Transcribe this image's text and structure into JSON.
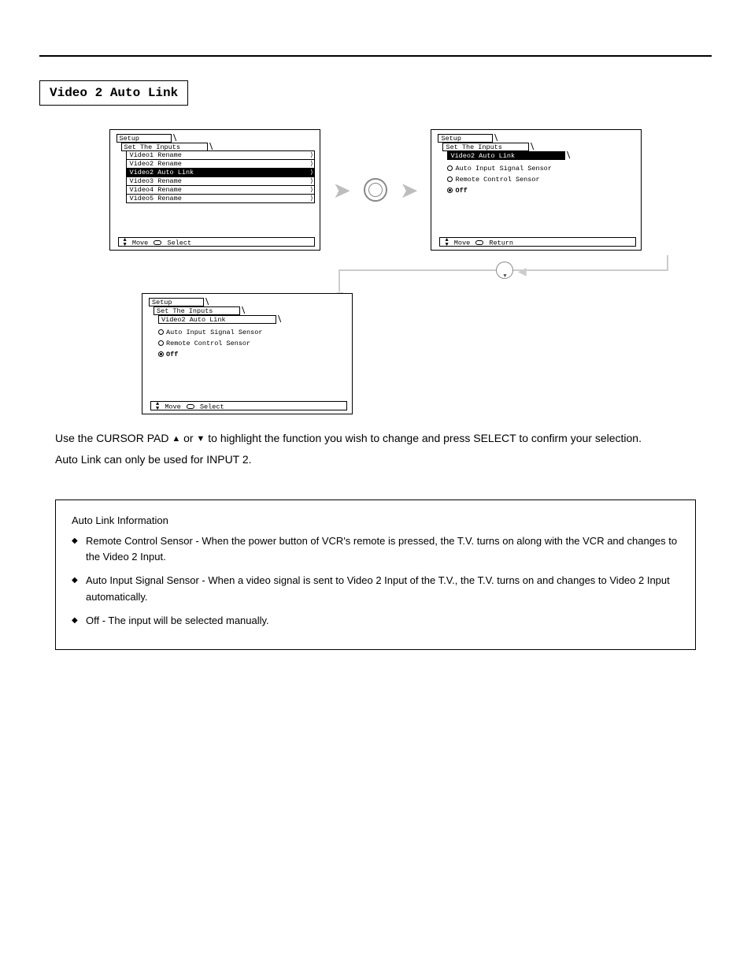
{
  "section_title": "Video 2 Auto Link",
  "screen1": {
    "tab1": "Setup",
    "tab2": "Set The Inputs",
    "items": [
      {
        "label": "Video1 Rename",
        "sel": false
      },
      {
        "label": "Video2 Rename",
        "sel": false
      },
      {
        "label": "Video2 Auto Link",
        "sel": true
      },
      {
        "label": "Video3 Rename",
        "sel": false
      },
      {
        "label": "Video4 Rename",
        "sel": false
      },
      {
        "label": "Video5 Rename",
        "sel": false
      }
    ],
    "footer_move": "Move",
    "footer_action": "Select"
  },
  "screen2": {
    "tab1": "Setup",
    "tab2": "Set The Inputs",
    "tab3": "Video2 Auto Link",
    "options": [
      {
        "label": "Auto Input Signal Sensor",
        "on": false,
        "bold": false
      },
      {
        "label": "Remote Control Sensor",
        "on": false,
        "bold": false
      },
      {
        "label": "Off",
        "on": true,
        "bold": true
      }
    ],
    "footer_move": "Move",
    "footer_action": "Return"
  },
  "screen3": {
    "tab1": "Setup",
    "tab2": "Set The Inputs",
    "tab3": "Video2 Auto Link",
    "options": [
      {
        "label": "Auto Input Signal Sensor",
        "on": false,
        "bold": false
      },
      {
        "label": "Remote Control Sensor",
        "on": false,
        "bold": false
      },
      {
        "label": "Off",
        "on": true,
        "bold": true
      }
    ],
    "footer_move": "Move",
    "footer_action": "Select"
  },
  "body": {
    "p1": "Use the CURSOR PAD ▲ or ▼ to highlight the function you wish to change and press SELECT to confirm your selection.",
    "p2a": "Auto Link can only be used for INPUT",
    "p2b": "2."
  },
  "info": {
    "title": "Auto Link Information",
    "bullets": [
      "Remote Control Sensor - When the power button of VCR's remote is pressed, the T.V. turns on along with the VCR and changes to the Video 2 Input.",
      "Auto Input Signal Sensor - When a video signal is sent to Video 2 Input of the T.V., the T.V. turns on and changes to Video 2 Input automatically.",
      "Off - The input will be selected manually."
    ]
  }
}
